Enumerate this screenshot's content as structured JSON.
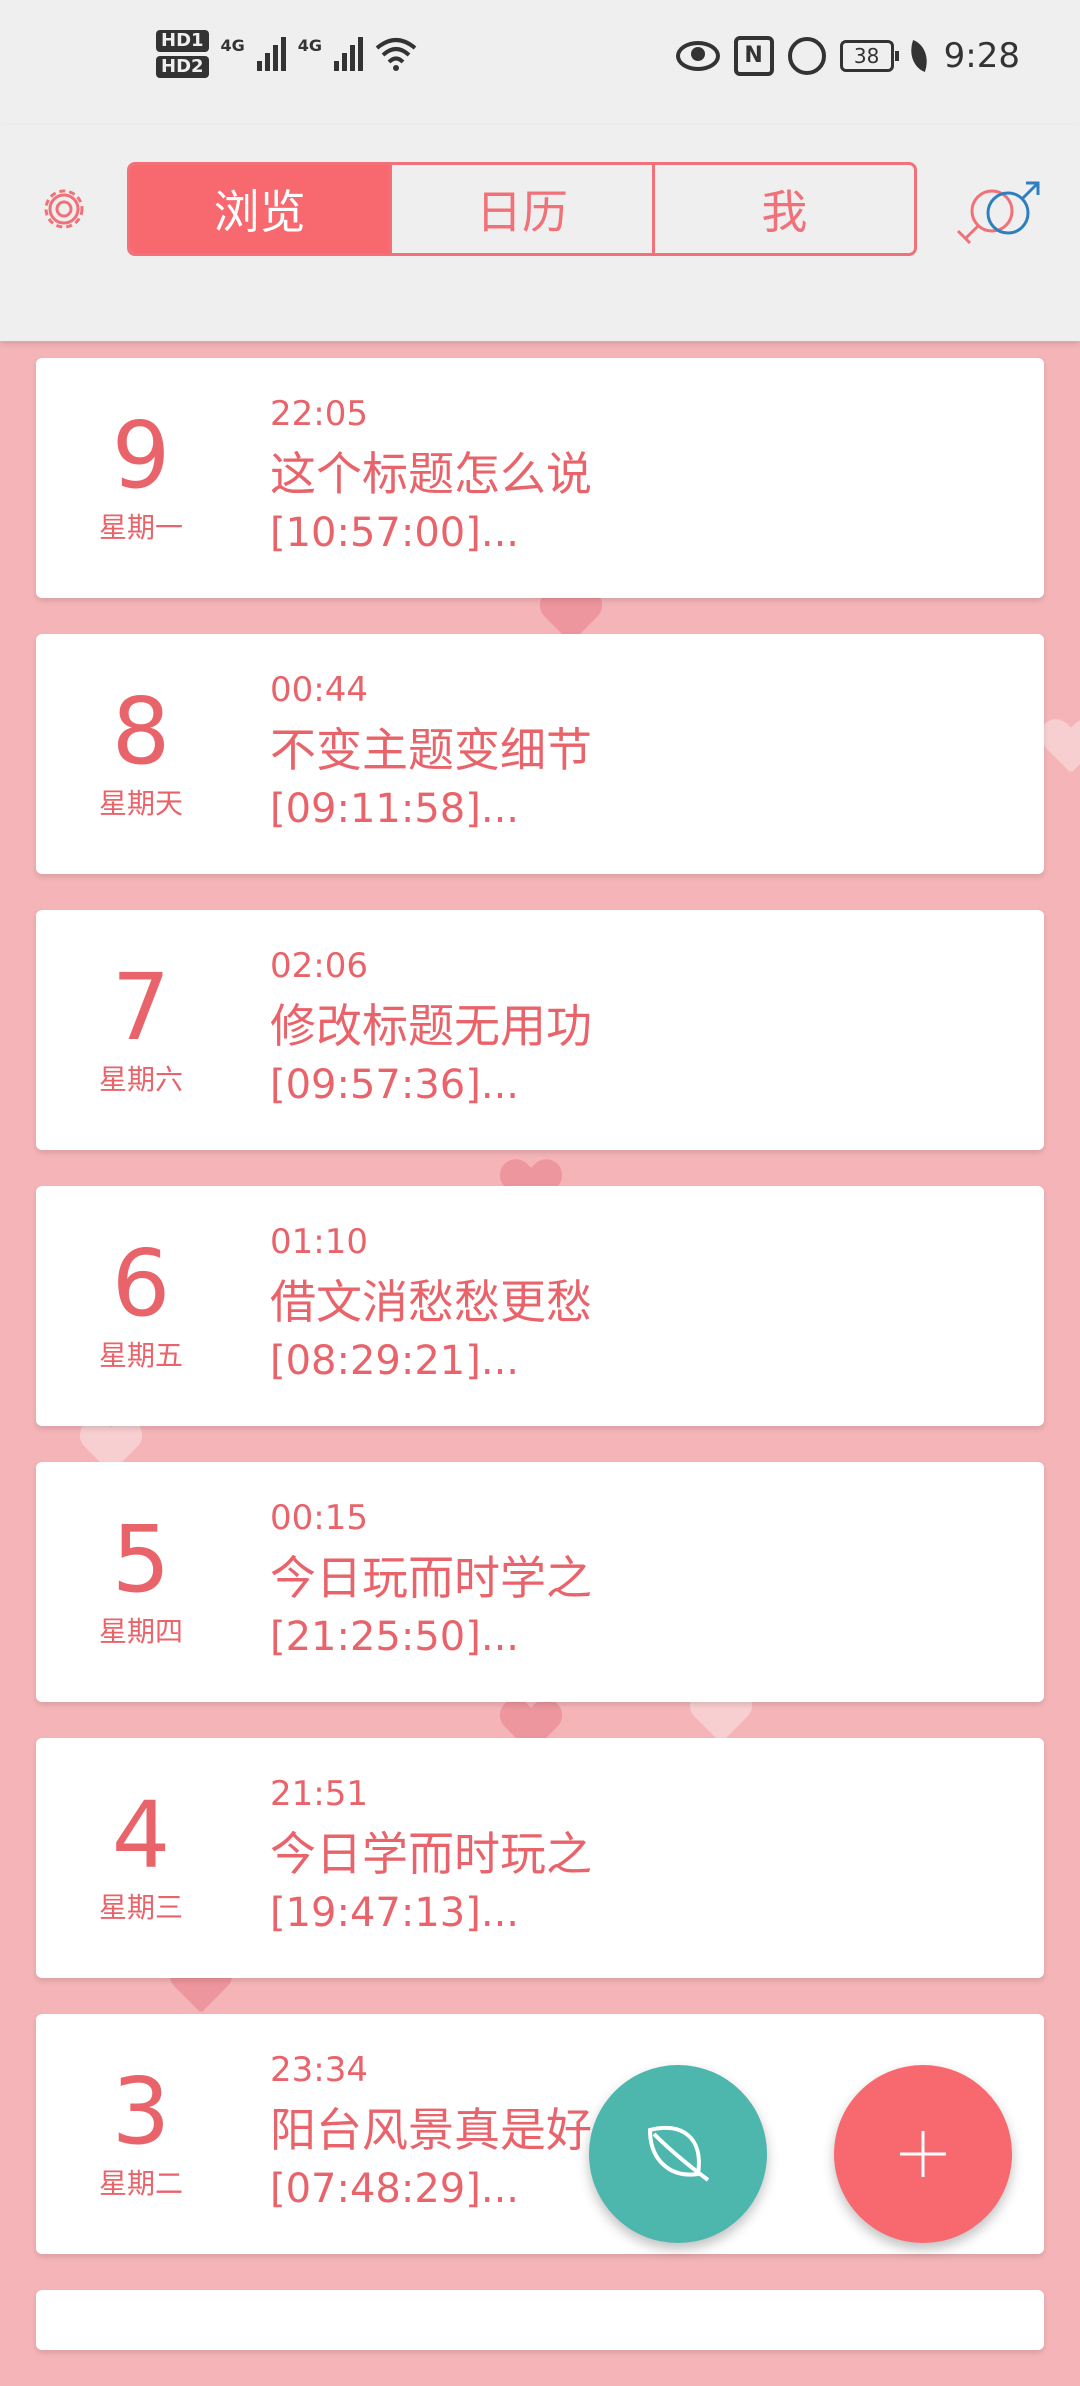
{
  "status_bar": {
    "hd1": "HD1",
    "hd2": "HD2",
    "net1": "4G",
    "net2": "4G",
    "nfc": "N",
    "battery": "38",
    "time": "9:28"
  },
  "header": {
    "tabs": [
      {
        "label": "浏览",
        "active": true
      },
      {
        "label": "日历",
        "active": false
      },
      {
        "label": "我",
        "active": false
      }
    ],
    "accent": "#f7696f"
  },
  "entries": [
    {
      "day": "9",
      "weekday": "星期一",
      "time": "22:05",
      "title": "这个标题怎么说",
      "snippet": "[10:57:00]..."
    },
    {
      "day": "8",
      "weekday": "星期天",
      "time": "00:44",
      "title": "不变主题变细节",
      "snippet": "[09:11:58]..."
    },
    {
      "day": "7",
      "weekday": "星期六",
      "time": "02:06",
      "title": "修改标题无用功",
      "snippet": "[09:57:36]..."
    },
    {
      "day": "6",
      "weekday": "星期五",
      "time": "01:10",
      "title": "借文消愁愁更愁",
      "snippet": "[08:29:21]..."
    },
    {
      "day": "5",
      "weekday": "星期四",
      "time": "00:15",
      "title": "今日玩而时学之",
      "snippet": "[21:25:50]..."
    },
    {
      "day": "4",
      "weekday": "星期三",
      "time": "21:51",
      "title": "今日学而时玩之",
      "snippet": "[19:47:13]..."
    },
    {
      "day": "3",
      "weekday": "星期二",
      "time": "23:34",
      "title": "阳台风景真是好",
      "snippet": "[07:48:29]..."
    }
  ],
  "fab_colors": {
    "leaf": "#4db6ad",
    "add": "#f7696f"
  },
  "icons": {
    "settings": "gear-icon",
    "profile": "gender-symbol-icon",
    "leaf_fab": "leaf-icon",
    "add_fab": "plus-icon"
  }
}
